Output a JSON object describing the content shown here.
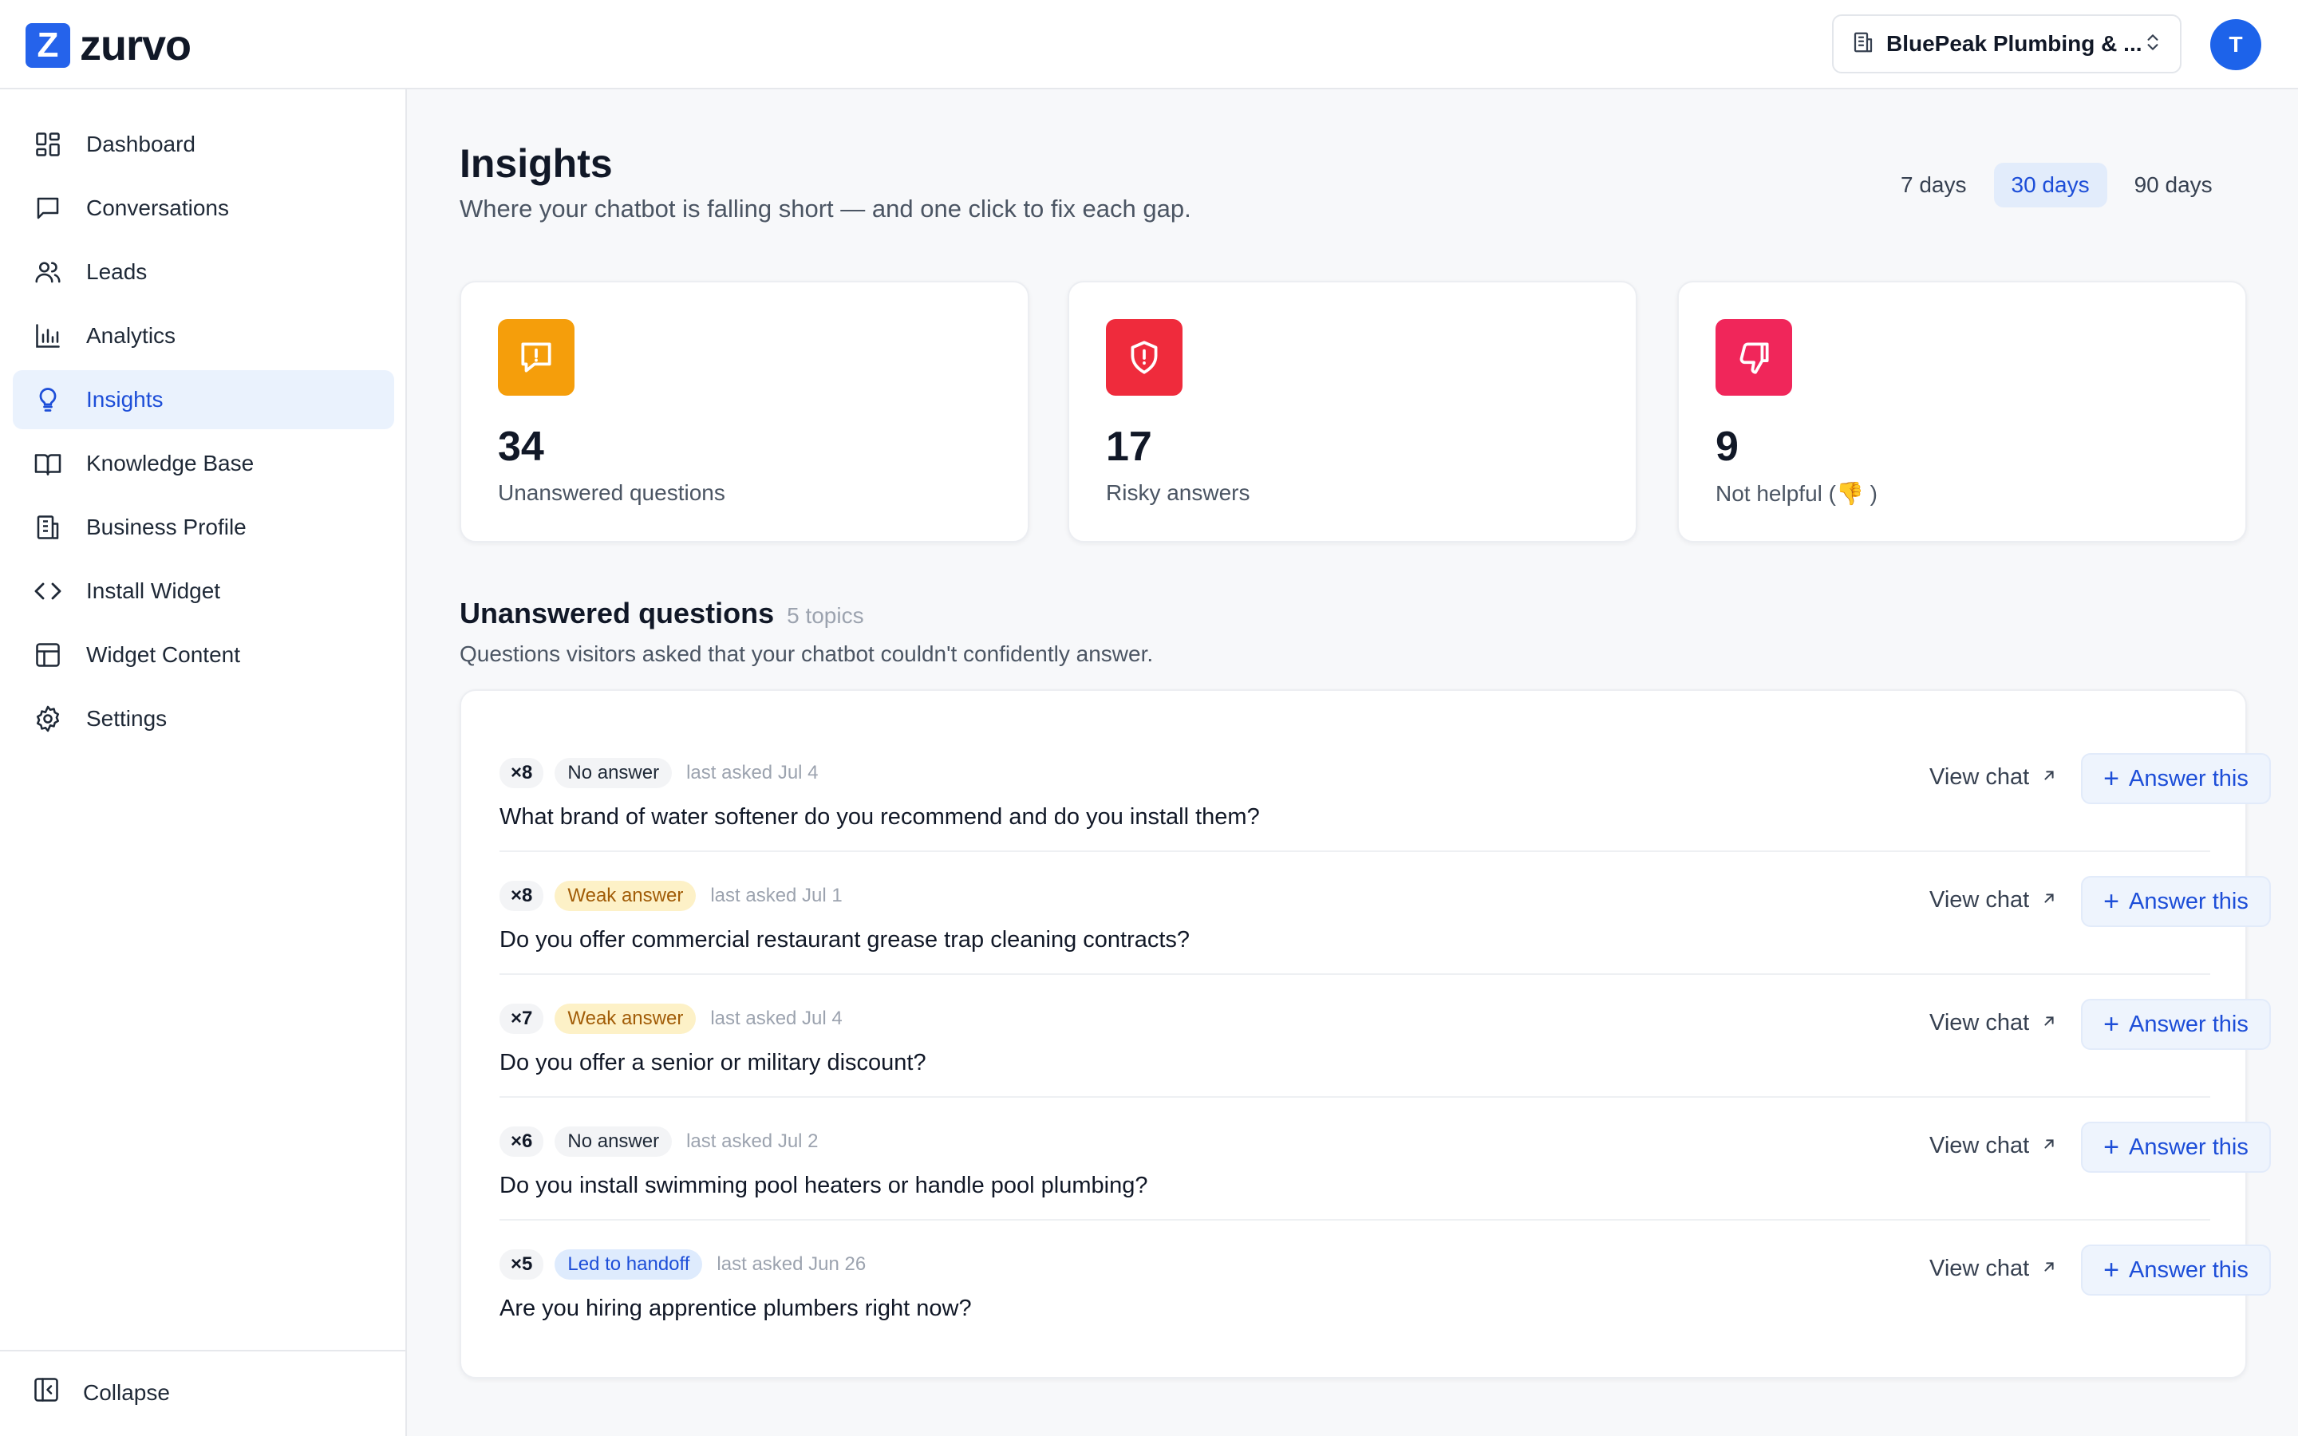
{
  "app": {
    "logo_mark": "Z",
    "logo_text": "zurvo",
    "business_name": "BluePeak Plumbing & ...",
    "avatar_initial": "T",
    "accent": "#2563eb"
  },
  "sidebar": {
    "items": [
      {
        "label": "Dashboard",
        "icon": "dashboard-icon"
      },
      {
        "label": "Conversations",
        "icon": "chat-bubble-icon"
      },
      {
        "label": "Leads",
        "icon": "users-icon"
      },
      {
        "label": "Analytics",
        "icon": "bar-chart-icon"
      },
      {
        "label": "Insights",
        "icon": "lightbulb-icon",
        "active": true
      },
      {
        "label": "Knowledge Base",
        "icon": "book-icon"
      },
      {
        "label": "Business Profile",
        "icon": "building-icon"
      },
      {
        "label": "Install Widget",
        "icon": "code-icon"
      },
      {
        "label": "Widget Content",
        "icon": "layout-icon"
      },
      {
        "label": "Settings",
        "icon": "gear-icon"
      }
    ],
    "collapse_label": "Collapse"
  },
  "page": {
    "title": "Insights",
    "subtitle": "Where your chatbot is falling short — and one click to fix each gap.",
    "ranges": [
      "7 days",
      "30 days",
      "90 days"
    ],
    "selected_range": "30 days"
  },
  "stats": [
    {
      "value": "34",
      "label": "Unanswered questions",
      "color": "#f59e0b",
      "icon": "message-alert-icon"
    },
    {
      "value": "17",
      "label": "Risky answers",
      "color": "#ef2b3c",
      "icon": "shield-alert-icon"
    },
    {
      "value": "9",
      "label": "Not helpful (👎 )",
      "color": "#f0265a",
      "icon": "thumbs-down-icon"
    }
  ],
  "unanswered": {
    "title": "Unanswered questions",
    "count_label": "5 topics",
    "subtitle": "Questions visitors asked that your chatbot couldn't confidently answer.",
    "view_chat_label": "View chat",
    "answer_label": "Answer this",
    "rows": [
      {
        "count": "×8",
        "status": "No answer",
        "status_kind": "none",
        "asked": "last asked Jul 4",
        "question": "What brand of water softener do you recommend and do you install them?"
      },
      {
        "count": "×8",
        "status": "Weak answer",
        "status_kind": "weak",
        "asked": "last asked Jul 1",
        "question": "Do you offer commercial restaurant grease trap cleaning contracts?"
      },
      {
        "count": "×7",
        "status": "Weak answer",
        "status_kind": "weak",
        "asked": "last asked Jul 4",
        "question": "Do you offer a senior or military discount?"
      },
      {
        "count": "×6",
        "status": "No answer",
        "status_kind": "none",
        "asked": "last asked Jul 2",
        "question": "Do you install swimming pool heaters or handle pool plumbing?"
      },
      {
        "count": "×5",
        "status": "Led to handoff",
        "status_kind": "handoff",
        "asked": "last asked Jun 26",
        "question": "Are you hiring apprentice plumbers right now?"
      }
    ]
  }
}
